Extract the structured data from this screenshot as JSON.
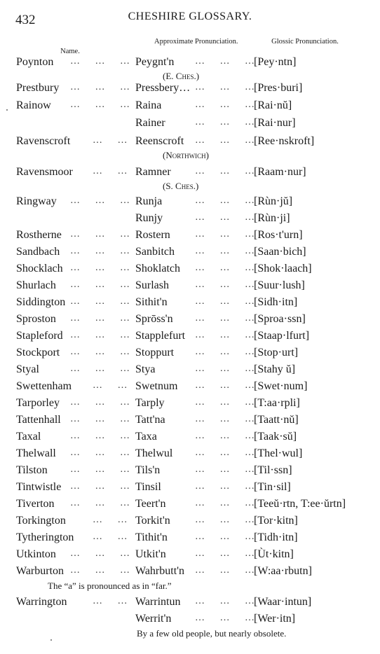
{
  "header": {
    "page_number": "432",
    "title": "CHESHIRE GLOSSARY."
  },
  "columns": {
    "name": "Name.",
    "approximate": "Approximate Pronunciation.",
    "glossic": "Glossic Pronunciation."
  },
  "entries": [
    {
      "name": "Poynton",
      "approx": "Peygnt'n",
      "glossic": "[Pey·ntn]",
      "region": "(E. Ches.)"
    },
    {
      "name": "Prestbury",
      "approx": "Pressbery…",
      "glossic": "[Pres·buri]"
    },
    {
      "name": "Rainow",
      "approx": "Raina",
      "glossic": "[Rai·nŭ]"
    },
    {
      "name": "",
      "approx": "Rainer",
      "glossic": "[Rai·nur]"
    },
    {
      "name": "Ravenscroft",
      "approx": "Reenscroft",
      "glossic": "[Ree·nskroft]",
      "region": "(Northwich)"
    },
    {
      "name": "Ravensmoor",
      "approx": "Ramner",
      "glossic": "[Raam·nur]",
      "region": "(S. Ches.)"
    },
    {
      "name": "Ringway",
      "approx": "Runja",
      "glossic": "[Rùn·jŭ]"
    },
    {
      "name": "",
      "approx": "Runjy",
      "glossic": "[Rùn·ji]"
    },
    {
      "name": "Rostherne",
      "approx": "Rostern",
      "glossic": "[Ros·t'urn]"
    },
    {
      "name": "Sandbach",
      "approx": "Sanbitch",
      "glossic": "[Saan·bich]"
    },
    {
      "name": "Shocklach",
      "approx": "Shoklatch",
      "glossic": "[Shok·laach]"
    },
    {
      "name": "Shurlach",
      "approx": "Surlash",
      "glossic": "[Suur·lush]"
    },
    {
      "name": "Siddington",
      "approx": "Sithit'n",
      "glossic": "[Sidh·itn]"
    },
    {
      "name": "Sproston",
      "approx": "Sprōss'n",
      "glossic": "[Sproa·ssn]"
    },
    {
      "name": "Stapleford",
      "approx": "Stapplefurt",
      "glossic": "[Staap·lfurt]"
    },
    {
      "name": "Stockport",
      "approx": "Stoppurt",
      "glossic": "[Stop·urt]"
    },
    {
      "name": "Styal",
      "approx": "Stya",
      "glossic": "[Stahy ŭ]"
    },
    {
      "name": "Swettenham",
      "approx": "Swetnum",
      "glossic": "[Swet·num]"
    },
    {
      "name": "Tarporley",
      "approx": "Tarply",
      "glossic": "[T:aa·rpli]"
    },
    {
      "name": "Tattenhall",
      "approx": "Tatt'na",
      "glossic": "[Taatt·nŭ]"
    },
    {
      "name": "Taxal",
      "approx": "Taxa",
      "glossic": "[Taak·sŭ]"
    },
    {
      "name": "Thelwall",
      "approx": "Thelwul",
      "glossic": "[Thel·wul]"
    },
    {
      "name": "Tilston",
      "approx": "Tils'n",
      "glossic": "[Til·ssn]"
    },
    {
      "name": "Tintwistle",
      "approx": "Tinsil",
      "glossic": "[Tin·sil]"
    },
    {
      "name": "Tiverton",
      "approx": "Teert'n",
      "glossic": "[Teeŭ·rtn, T:ee·ŭrtn]"
    },
    {
      "name": "Torkington",
      "approx": "Torkit'n",
      "glossic": "[Tor·kitn]"
    },
    {
      "name": "Tytherington",
      "approx": "Tithit'n",
      "glossic": "[Tidh·itn]"
    },
    {
      "name": "Utkinton",
      "approx": "Utkit'n",
      "glossic": "[Ùt·kitn]"
    },
    {
      "name": "Warburton",
      "approx": "Wahrbutt'n",
      "glossic": "[W:aa·rbutn]",
      "note": "The “a” is pronounced as in “far.”"
    },
    {
      "name": "Warrington",
      "approx": "Warrintun",
      "glossic": "[Waar·intun]"
    },
    {
      "name": "",
      "approx": "Werrit'n",
      "glossic": "[Wer·itn]",
      "note": "By a few old people, but nearly obsolete."
    }
  ],
  "leader": "…  …  …"
}
